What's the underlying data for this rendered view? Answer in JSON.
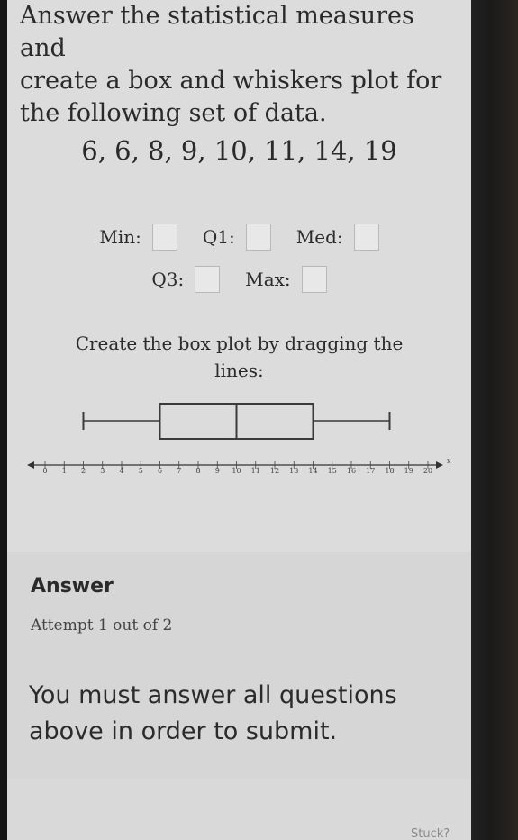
{
  "question": {
    "text": "Answer the statistical measures and\ncreate a box and whiskers plot for\nthe following set of data."
  },
  "dataset": "6, 6, 8, 9, 10, 11, 14, 19",
  "measures": {
    "min_label": "Min:",
    "q1_label": "Q1:",
    "med_label": "Med:",
    "q3_label": "Q3:",
    "max_label": "Max:"
  },
  "instruction": "Create the box plot by dragging the lines:",
  "boxplot": {
    "axis_min": 0,
    "axis_max": 20,
    "axis_variable": "x",
    "whisker_min": 2,
    "q1": 6,
    "median": 10,
    "q3": 14,
    "whisker_max": 18,
    "ticks": [
      "0",
      "1",
      "2",
      "3",
      "4",
      "5",
      "6",
      "7",
      "8",
      "9",
      "10",
      "11",
      "12",
      "13",
      "14",
      "15",
      "16",
      "17",
      "18",
      "19",
      "20"
    ]
  },
  "answer": {
    "heading": "Answer",
    "attempt": "Attempt 1 out of 2",
    "warning": "You must answer all questions above in order to submit."
  },
  "footer": {
    "cut_text": "Stuck?"
  },
  "colors": {
    "screen_bg": "#dcdcdc",
    "box_stroke": "#3a3a3a"
  }
}
